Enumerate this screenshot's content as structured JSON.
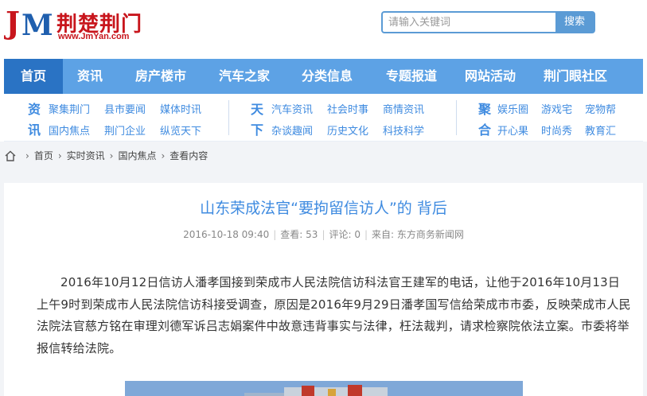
{
  "header": {
    "logo_text": "荆楚荆门",
    "logo_url": "www.JmYan.com",
    "search_placeholder": "请输入关键词",
    "search_button": "搜索"
  },
  "nav": {
    "items": [
      {
        "label": "首页",
        "active": true
      },
      {
        "label": "资讯",
        "active": false
      },
      {
        "label": "房产楼市",
        "active": false
      },
      {
        "label": "汽车之家",
        "active": false
      },
      {
        "label": "分类信息",
        "active": false
      },
      {
        "label": "专题报道",
        "active": false
      },
      {
        "label": "网站活动",
        "active": false
      },
      {
        "label": "荆门眼社区",
        "active": false
      }
    ]
  },
  "subnav": {
    "groups": [
      {
        "title": [
          "资",
          "讯"
        ],
        "rows": [
          [
            "聚集荆门",
            "县市要闻",
            "媒体时讯"
          ],
          [
            "国内焦点",
            "荆门企业",
            "纵览天下"
          ]
        ]
      },
      {
        "title": [
          "天",
          "下"
        ],
        "rows": [
          [
            "汽车资讯",
            "社会时事",
            "商情资讯"
          ],
          [
            "杂谈趣闻",
            "历史文化",
            "科技科学"
          ]
        ]
      },
      {
        "title": [
          "聚",
          "合"
        ],
        "rows": [
          [
            "娱乐圈",
            "游戏宅",
            "宠物帮"
          ],
          [
            "开心果",
            "时尚秀",
            "教育汇"
          ]
        ]
      }
    ]
  },
  "breadcrumb": [
    "首页",
    "实时资讯",
    "国内焦点",
    "查看内容"
  ],
  "article": {
    "title": "山东荣成法官“要拘留信访人”的 背后",
    "date": "2016-10-18 09:40",
    "views": "查看: 53",
    "comments": "评论: 0",
    "source": "来自: 东方商务新闻网",
    "body": "2016年10月12日信访人潘孝国接到荣成市人民法院信访科法官王建军的电话，让他于2016年10月13日上午9时到荣成市人民法院信访科接受调查，原因是2016年9月29日潘孝国写信给荣成市市委，反映荣成市人民法院法官慈方铭在审理刘德军诉吕志娟案件中故意违背事实与法律，枉法裁判，请求检察院依法立案。市委将举报信转给法院。"
  },
  "colors": {
    "brand_red": "#c8161d",
    "nav_blue": "#5da2e5",
    "nav_active": "#2a73c4",
    "link_blue": "#3f8be0"
  }
}
